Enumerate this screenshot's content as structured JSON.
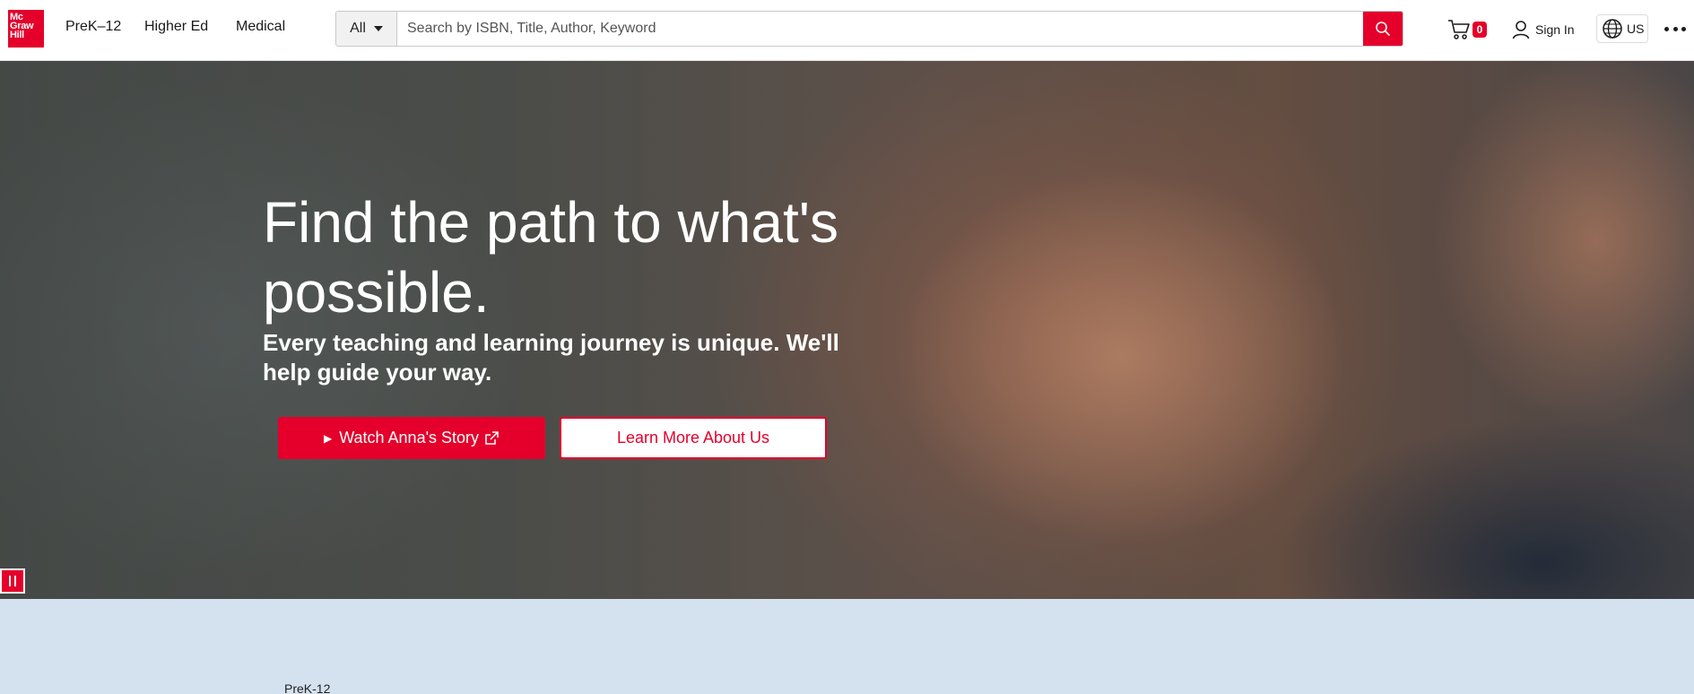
{
  "brand": {
    "logo_lines": [
      "Mc",
      "Graw",
      "Hill"
    ],
    "accent": "#e4002b"
  },
  "nav": {
    "items": [
      {
        "label": "PreK–12"
      },
      {
        "label": "Higher Ed"
      },
      {
        "label": "Medical"
      }
    ]
  },
  "search": {
    "scope": "All",
    "placeholder": "Search by ISBN, Title, Author, Keyword",
    "value": ""
  },
  "header_actions": {
    "cart_count": "0",
    "sign_in_label": "Sign In",
    "locale_label": "US"
  },
  "hero": {
    "title": "Find the path to what's possible.",
    "subtitle": "Every teaching and learning journey is unique. We'll help guide your way.",
    "primary_cta": "Watch Anna's Story",
    "secondary_cta": "Learn More About Us"
  },
  "section": {
    "label": "PreK-12",
    "background": "#d4e2ef"
  }
}
